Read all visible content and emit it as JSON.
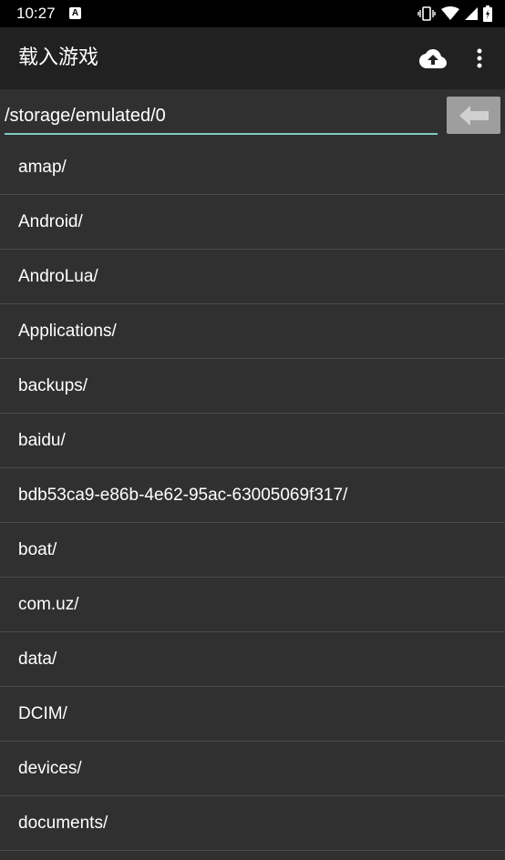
{
  "status_bar": {
    "time": "10:27",
    "notification_letter": "A"
  },
  "app_bar": {
    "title": "载入游戏",
    "upload_icon": "cloud-upload-icon",
    "menu_icon": "more-vert-icon"
  },
  "path_bar": {
    "value": "/storage/emulated/0",
    "back_icon": "arrow-left-icon"
  },
  "files": [
    {
      "name": "amap/"
    },
    {
      "name": "Android/"
    },
    {
      "name": "AndroLua/"
    },
    {
      "name": "Applications/"
    },
    {
      "name": "backups/"
    },
    {
      "name": "baidu/"
    },
    {
      "name": "bdb53ca9-e86b-4e62-95ac-63005069f317/"
    },
    {
      "name": "boat/"
    },
    {
      "name": "com.uz/"
    },
    {
      "name": "data/"
    },
    {
      "name": "DCIM/"
    },
    {
      "name": "devices/"
    },
    {
      "name": "documents/"
    }
  ],
  "colors": {
    "background": "#303030",
    "app_bar": "#212121",
    "status_bar": "#000000",
    "input_underline": "#80cbc4",
    "back_button": "#9e9e9e"
  }
}
